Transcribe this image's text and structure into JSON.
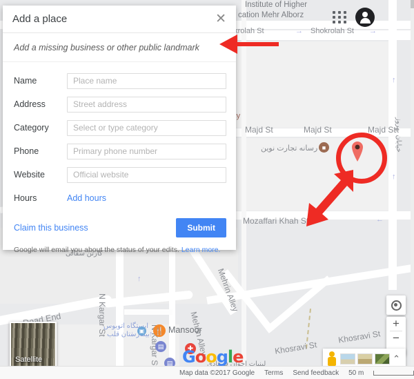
{
  "panel": {
    "title": "Add a place",
    "close_icon": "close-icon",
    "subtitle": "Add a missing business or other public landmark",
    "fields": [
      {
        "label": "Name",
        "placeholder": "Place name"
      },
      {
        "label": "Address",
        "placeholder": "Street address"
      },
      {
        "label": "Category",
        "placeholder": "Select or type category"
      },
      {
        "label": "Phone",
        "placeholder": "Primary phone number"
      },
      {
        "label": "Website",
        "placeholder": "Official website"
      }
    ],
    "hours_label": "Hours",
    "hours_link": "Add hours",
    "claim_link": "Claim this business",
    "submit_label": "Submit",
    "note_text": "Google will email you about the status of your edits.",
    "note_link": "Learn more."
  },
  "header": {
    "apps_icon": "google-apps-grid-icon",
    "avatar_icon": "account-avatar-icon"
  },
  "map": {
    "labels": [
      {
        "text": "Institute of Higher"
      },
      {
        "text": "cation Mehr Alborz"
      },
      {
        "text": "okrolah St"
      },
      {
        "text": "Shokrolah St"
      },
      {
        "text": "Majd St"
      },
      {
        "text": "Majd St"
      },
      {
        "text": "Majd St"
      },
      {
        "text": "Mozaffari Khah St"
      },
      {
        "text": "Khosravi St"
      },
      {
        "text": "Khosravi St"
      },
      {
        "text": "N Kargar St"
      },
      {
        "text": "N Kargar St"
      },
      {
        "text": "Mehrin Alley"
      },
      {
        "text": "Mehrin Alley"
      },
      {
        "text": "Dead End"
      },
      {
        "text": "Mansoor"
      },
      {
        "text": "ucy"
      }
    ],
    "persian_labels": [
      {
        "text": "رسانه تجارت نوین"
      },
      {
        "text": "ایستگاه اتوبوس"
      },
      {
        "text": "بیمارستان قلب"
      },
      {
        "text": "لبنیات اخوان فرهادی"
      },
      {
        "text": "کارتن سفالی"
      },
      {
        "text": "خیابان بهروز"
      }
    ],
    "google_logo": [
      "G",
      "o",
      "o",
      "g",
      "l",
      "e"
    ],
    "satellite_label": "Satellite",
    "satellite_icon": "satellite-thumbnail-icon",
    "marker_icon": "map-pin-marker",
    "controls": {
      "my_location_icon": "my-location-icon",
      "zoom_in_label": "+",
      "zoom_out_label": "−",
      "pegman_icon": "street-view-pegman-icon",
      "expand_icon": "chevron-up-icon",
      "layer_thumbs": [
        "layer-thumb-terrain",
        "layer-thumb-satellite",
        "layer-thumb-earth"
      ]
    }
  },
  "footer": {
    "attribution": "Map data ©2017 Google",
    "terms": "Terms",
    "feedback": "Send feedback",
    "scale": "50 m"
  },
  "annotations": {
    "arrow_to_panel": "red-arrow-left",
    "circle_marker": "red-circle-highlight",
    "arrow_to_marker": "red-arrow-diagonal",
    "color": "#ee2b24"
  },
  "colors": {
    "accent_blue": "#4285f4",
    "annotation_red": "#ee2b24",
    "map_bg": "#e9eaec"
  }
}
